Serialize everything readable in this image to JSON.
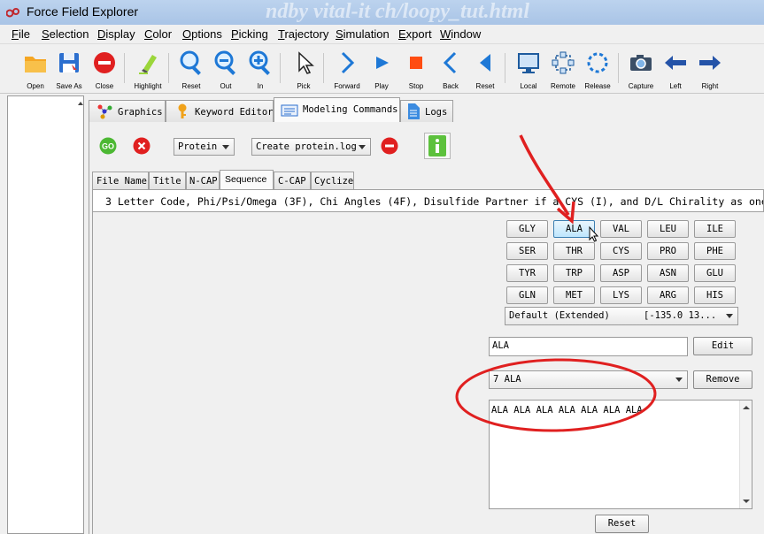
{
  "window": {
    "title": "Force Field Explorer",
    "background_text": "ndby vital-it ch/loopy_tut.html"
  },
  "menu": [
    {
      "accel": "F",
      "rest": "ile"
    },
    {
      "accel": "S",
      "rest": "election"
    },
    {
      "accel": "D",
      "rest": "isplay"
    },
    {
      "accel": "C",
      "rest": "olor"
    },
    {
      "accel": "O",
      "rest": "ptions"
    },
    {
      "accel": "P",
      "rest": "icking"
    },
    {
      "accel": "T",
      "rest": "rajectory"
    },
    {
      "accel": "S",
      "rest": "imulation"
    },
    {
      "accel": "E",
      "rest": "xport"
    },
    {
      "accel": "W",
      "rest": "indow"
    }
  ],
  "toolbar": {
    "open": "Open",
    "save_as": "Save As",
    "close": "Close",
    "highlight": "Highlight",
    "reset": "Reset",
    "out": "Out",
    "in": "In",
    "pick": "Pick",
    "forward": "Forward",
    "play": "Play",
    "stop": "Stop",
    "back": "Back",
    "reset2": "Reset",
    "local": "Local",
    "remote": "Remote",
    "release": "Release",
    "capture": "Capture",
    "left": "Left",
    "right": "Right"
  },
  "tabs": {
    "graphics": "Graphics",
    "keyword_editor": "Keyword Editor",
    "modeling_commands": "Modeling Commands",
    "logs": "Logs"
  },
  "command_bar": {
    "go": "GO",
    "type_select": "Protein",
    "command_select": "Create protein.log"
  },
  "subtabs": {
    "file_name": "File Name",
    "title": "Title",
    "n_cap": "N-CAP",
    "sequence": "Sequence",
    "c_cap": "C-CAP",
    "cyclize": "Cyclize"
  },
  "description": "3 Letter Code, Phi/Psi/Omega (3F), Chi Angles (4F),  Disulfide Partner if a CYS (I), and D/L Chirality as one",
  "amino_acids": [
    [
      "GLY",
      "ALA",
      "VAL",
      "LEU",
      "ILE"
    ],
    [
      "SER",
      "THR",
      "CYS",
      "PRO",
      "PHE"
    ],
    [
      "TYR",
      "TRP",
      "ASP",
      "ASN",
      "GLU"
    ],
    [
      "GLN",
      "MET",
      "LYS",
      "ARG",
      "HIS"
    ]
  ],
  "conformation_select": {
    "name": "Default (Extended)",
    "values": "[-135.0  13..."
  },
  "residue_field": {
    "value": "ALA",
    "edit_button": "Edit"
  },
  "residue_list": {
    "selected": "7 ALA",
    "remove_button": "Remove"
  },
  "sequence_text": "ALA ALA ALA ALA ALA ALA ALA",
  "reset_button": "Reset",
  "colors": {
    "accent_red": "#e02020",
    "go_green": "#4cb833",
    "info_green": "#5cc13c",
    "toolbar_blue": "#1e78d6"
  }
}
